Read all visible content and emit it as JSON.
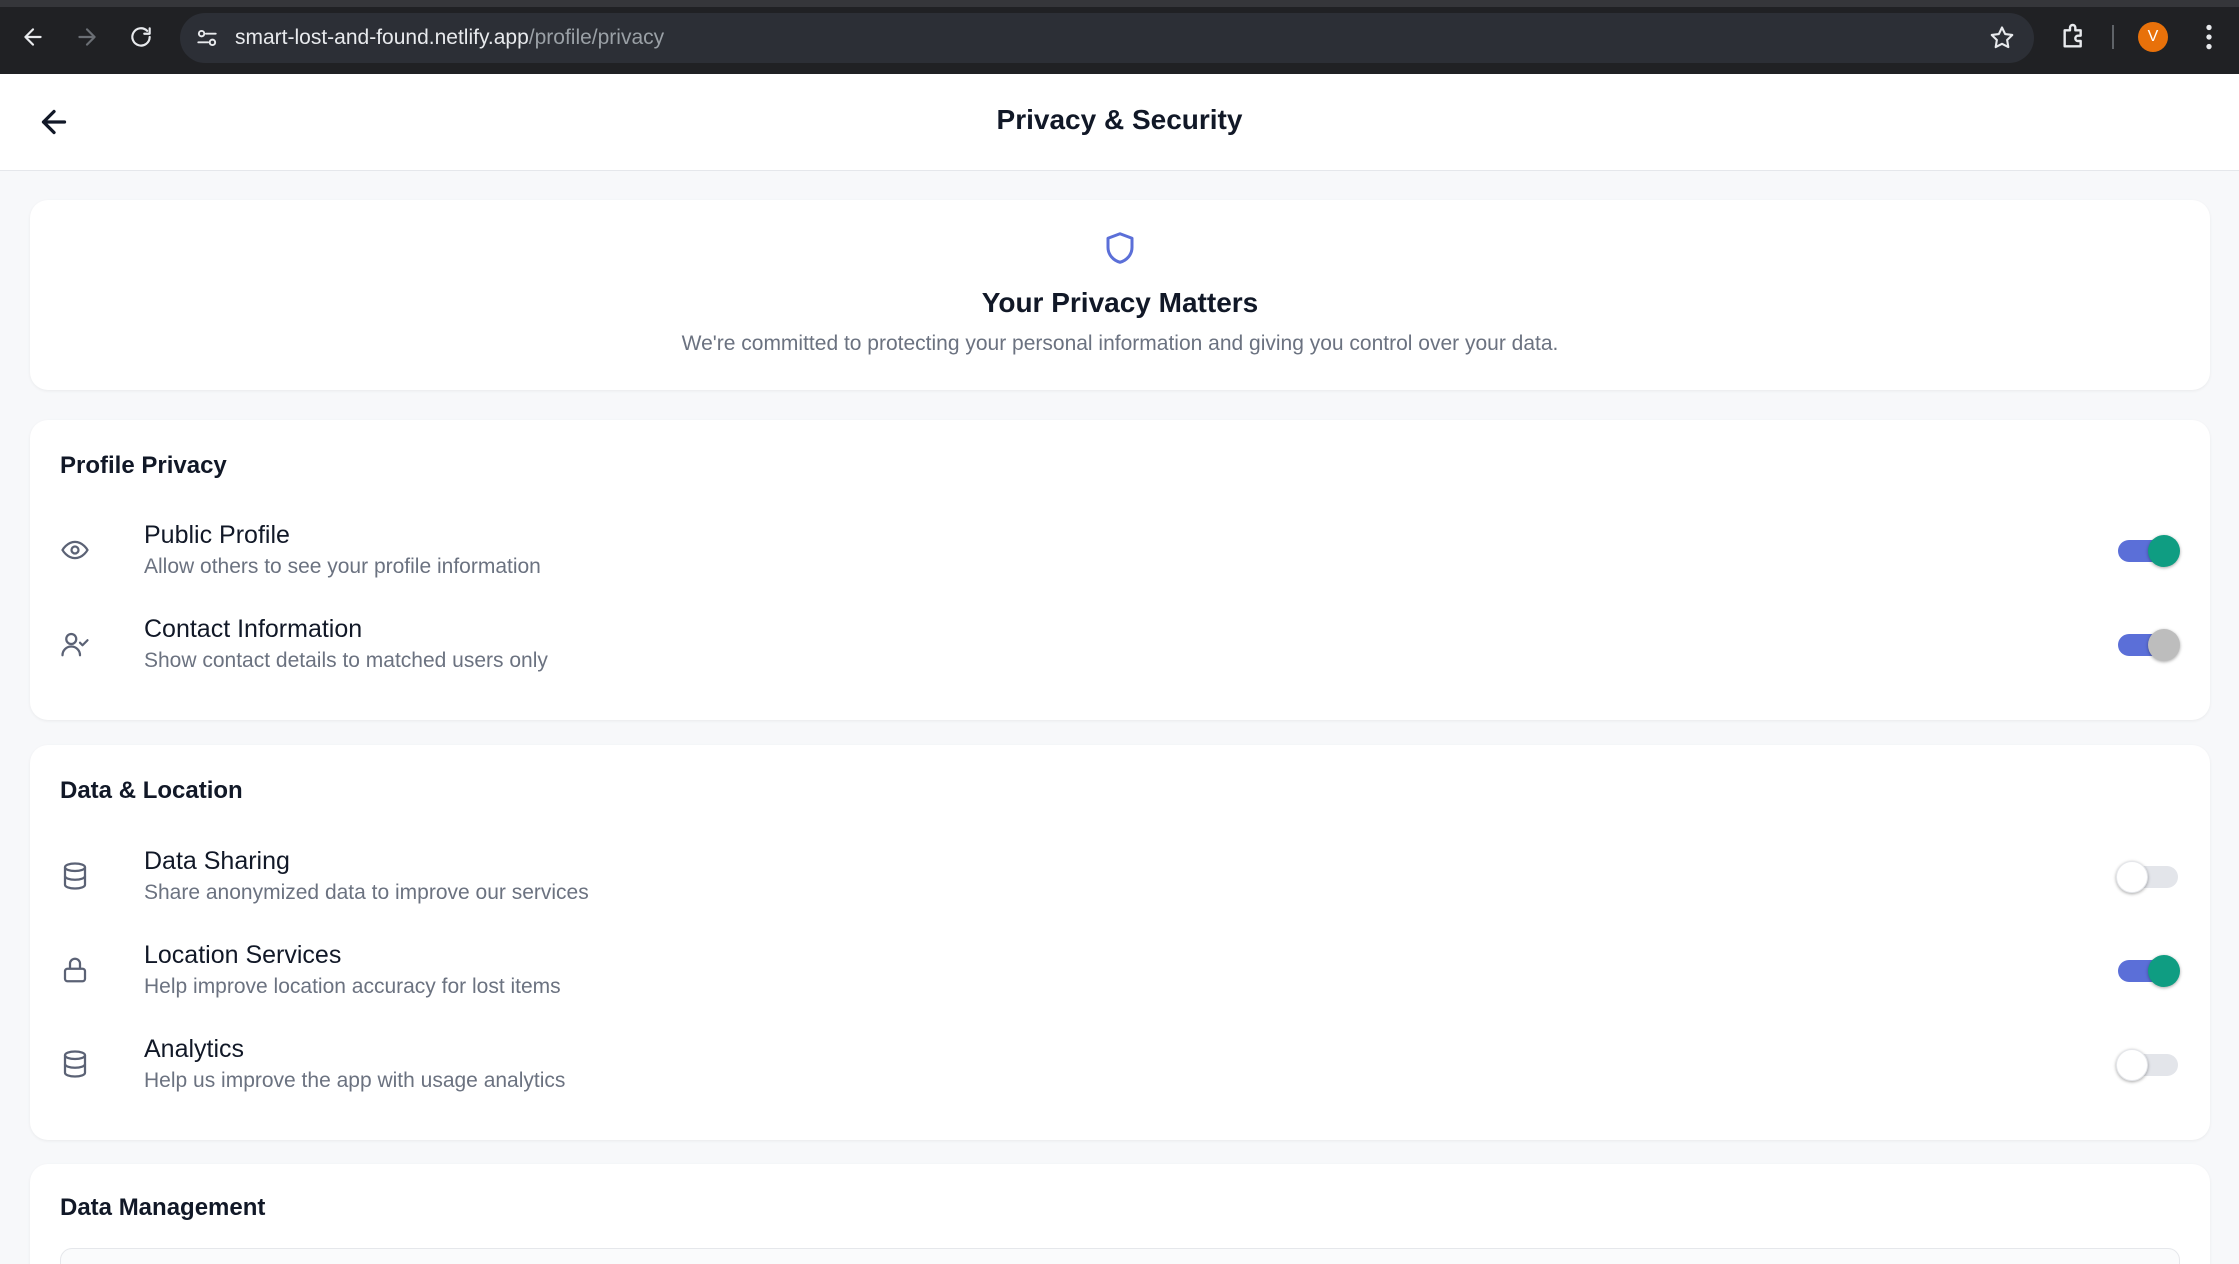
{
  "browser": {
    "url_host": "smart-lost-and-found.netlify.app",
    "url_path": "/profile/privacy",
    "avatar_letter": "V",
    "avatar_color": "#e8710a"
  },
  "header": {
    "title": "Privacy & Security"
  },
  "hero": {
    "icon": "shield-icon",
    "heading": "Your Privacy Matters",
    "description": "We're committed to protecting your personal information and giving you control over your data."
  },
  "sections": [
    {
      "title": "Profile Privacy",
      "items": [
        {
          "icon": "eye-icon",
          "label": "Public Profile",
          "description": "Allow others to see your profile information",
          "enabled": true
        },
        {
          "icon": "user-check-icon",
          "label": "Contact Information",
          "description": "Show contact details to matched users only",
          "enabled": true
        }
      ]
    },
    {
      "title": "Data & Location",
      "items": [
        {
          "icon": "database-icon",
          "label": "Data Sharing",
          "description": "Share anonymized data to improve our services",
          "enabled": false
        },
        {
          "icon": "lock-icon",
          "label": "Location Services",
          "description": "Help improve location accuracy for lost items",
          "enabled": true
        },
        {
          "icon": "database-icon",
          "label": "Analytics",
          "description": "Help us improve the app with usage analytics",
          "enabled": false
        }
      ]
    },
    {
      "title": "Data Management",
      "items": []
    }
  ],
  "colors": {
    "toggle_track_on": "#5b6fd8",
    "toggle_knob_on": "#0f9d82",
    "accent_icon": "#5b6fd8"
  }
}
